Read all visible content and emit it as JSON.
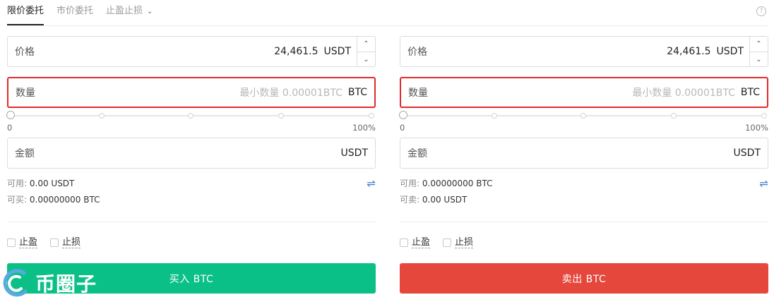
{
  "tabs": [
    {
      "label": "限价委托",
      "active": true
    },
    {
      "label": "市价委托",
      "active": false
    },
    {
      "label": "止盈止损",
      "active": false
    }
  ],
  "help_icon": "?",
  "buy": {
    "price_label": "价格",
    "price_value": "24,461.5",
    "price_unit": "USDT",
    "qty_label": "数量",
    "qty_placeholder": "最小数量 0.00001BTC",
    "qty_unit": "BTC",
    "slider_min": "0",
    "slider_max": "100%",
    "slider_value": 0,
    "amount_label": "金额",
    "amount_unit": "USDT",
    "available_label": "可用:",
    "available_value": "0.00 USDT",
    "can_trade_label": "可买:",
    "can_trade_value": "0.00000000 BTC",
    "take_profit": "止盈",
    "stop_loss": "止损",
    "action_label": "买入 BTC",
    "color": "#0bc087"
  },
  "sell": {
    "price_label": "价格",
    "price_value": "24,461.5",
    "price_unit": "USDT",
    "qty_label": "数量",
    "qty_placeholder": "最小数量 0.00001BTC",
    "qty_unit": "BTC",
    "slider_min": "0",
    "slider_max": "100%",
    "slider_value": 0,
    "amount_label": "金额",
    "amount_unit": "USDT",
    "available_label": "可用:",
    "available_value": "0.00000000 BTC",
    "can_trade_label": "可卖:",
    "can_trade_value": "0.00 USDT",
    "take_profit": "止盈",
    "stop_loss": "止损",
    "action_label": "卖出 BTC",
    "color": "#e5473d"
  },
  "icons": {
    "stepper_up": "^",
    "stepper_down": "v",
    "swap": "⇌",
    "chevron": "∨"
  },
  "watermark": {
    "text": "币圈子"
  }
}
